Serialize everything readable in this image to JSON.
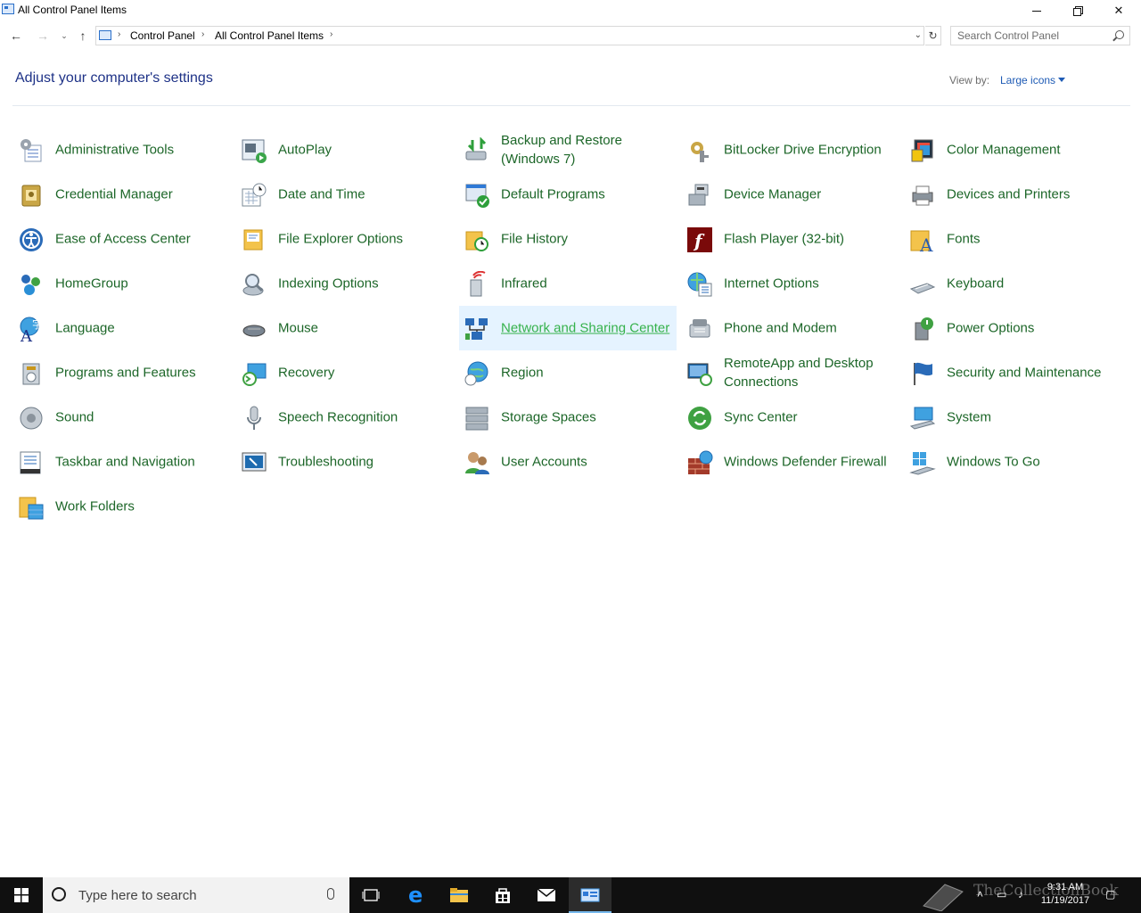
{
  "window": {
    "title": "All Control Panel Items"
  },
  "address": {
    "crumbs": [
      "Control Panel",
      "All Control Panel Items"
    ]
  },
  "search": {
    "placeholder": "Search Control Panel"
  },
  "header": {
    "heading": "Adjust your computer's settings",
    "view_by_label": "View by:",
    "view_by_value": "Large icons"
  },
  "items": [
    {
      "label": "Administrative Tools",
      "icon": "administrative-tools-icon"
    },
    {
      "label": "AutoPlay",
      "icon": "autoplay-icon"
    },
    {
      "label": "Backup and Restore (Windows 7)",
      "icon": "backup-restore-icon"
    },
    {
      "label": "BitLocker Drive Encryption",
      "icon": "bitlocker-icon"
    },
    {
      "label": "Color Management",
      "icon": "color-management-icon"
    },
    {
      "label": "Credential Manager",
      "icon": "credential-manager-icon"
    },
    {
      "label": "Date and Time",
      "icon": "date-time-icon"
    },
    {
      "label": "Default Programs",
      "icon": "default-programs-icon"
    },
    {
      "label": "Device Manager",
      "icon": "device-manager-icon"
    },
    {
      "label": "Devices and Printers",
      "icon": "devices-printers-icon"
    },
    {
      "label": "Ease of Access Center",
      "icon": "ease-of-access-icon"
    },
    {
      "label": "File Explorer Options",
      "icon": "file-explorer-options-icon"
    },
    {
      "label": "File History",
      "icon": "file-history-icon"
    },
    {
      "label": "Flash Player (32-bit)",
      "icon": "flash-player-icon"
    },
    {
      "label": "Fonts",
      "icon": "fonts-icon"
    },
    {
      "label": "HomeGroup",
      "icon": "homegroup-icon"
    },
    {
      "label": "Indexing Options",
      "icon": "indexing-options-icon"
    },
    {
      "label": "Infrared",
      "icon": "infrared-icon"
    },
    {
      "label": "Internet Options",
      "icon": "internet-options-icon"
    },
    {
      "label": "Keyboard",
      "icon": "keyboard-icon"
    },
    {
      "label": "Language",
      "icon": "language-icon"
    },
    {
      "label": "Mouse",
      "icon": "mouse-icon"
    },
    {
      "label": "Network and Sharing Center",
      "icon": "network-sharing-icon"
    },
    {
      "label": "Phone and Modem",
      "icon": "phone-modem-icon"
    },
    {
      "label": "Power Options",
      "icon": "power-options-icon"
    },
    {
      "label": "Programs and Features",
      "icon": "programs-features-icon"
    },
    {
      "label": "Recovery",
      "icon": "recovery-icon"
    },
    {
      "label": "Region",
      "icon": "region-icon"
    },
    {
      "label": "RemoteApp and Desktop Connections",
      "icon": "remoteapp-icon"
    },
    {
      "label": "Security and Maintenance",
      "icon": "security-maintenance-icon"
    },
    {
      "label": "Sound",
      "icon": "sound-icon"
    },
    {
      "label": "Speech Recognition",
      "icon": "speech-recognition-icon"
    },
    {
      "label": "Storage Spaces",
      "icon": "storage-spaces-icon"
    },
    {
      "label": "Sync Center",
      "icon": "sync-center-icon"
    },
    {
      "label": "System",
      "icon": "system-icon"
    },
    {
      "label": "Taskbar and Navigation",
      "icon": "taskbar-navigation-icon"
    },
    {
      "label": "Troubleshooting",
      "icon": "troubleshooting-icon"
    },
    {
      "label": "User Accounts",
      "icon": "user-accounts-icon"
    },
    {
      "label": "Windows Defender Firewall",
      "icon": "firewall-icon"
    },
    {
      "label": "Windows To Go",
      "icon": "windows-to-go-icon"
    },
    {
      "label": "Work Folders",
      "icon": "work-folders-icon"
    }
  ],
  "hovered_item": "Network and Sharing Center",
  "taskbar": {
    "search_placeholder": "Type here to search",
    "time": "9:31 AM",
    "date": "11/19/2017",
    "watermark": "TheCollectionBook"
  },
  "colors": {
    "link_green": "#1c6628",
    "hover_bg": "#e5f3ff",
    "heading_blue": "#1e3287",
    "taskbar_bg": "#101010"
  }
}
